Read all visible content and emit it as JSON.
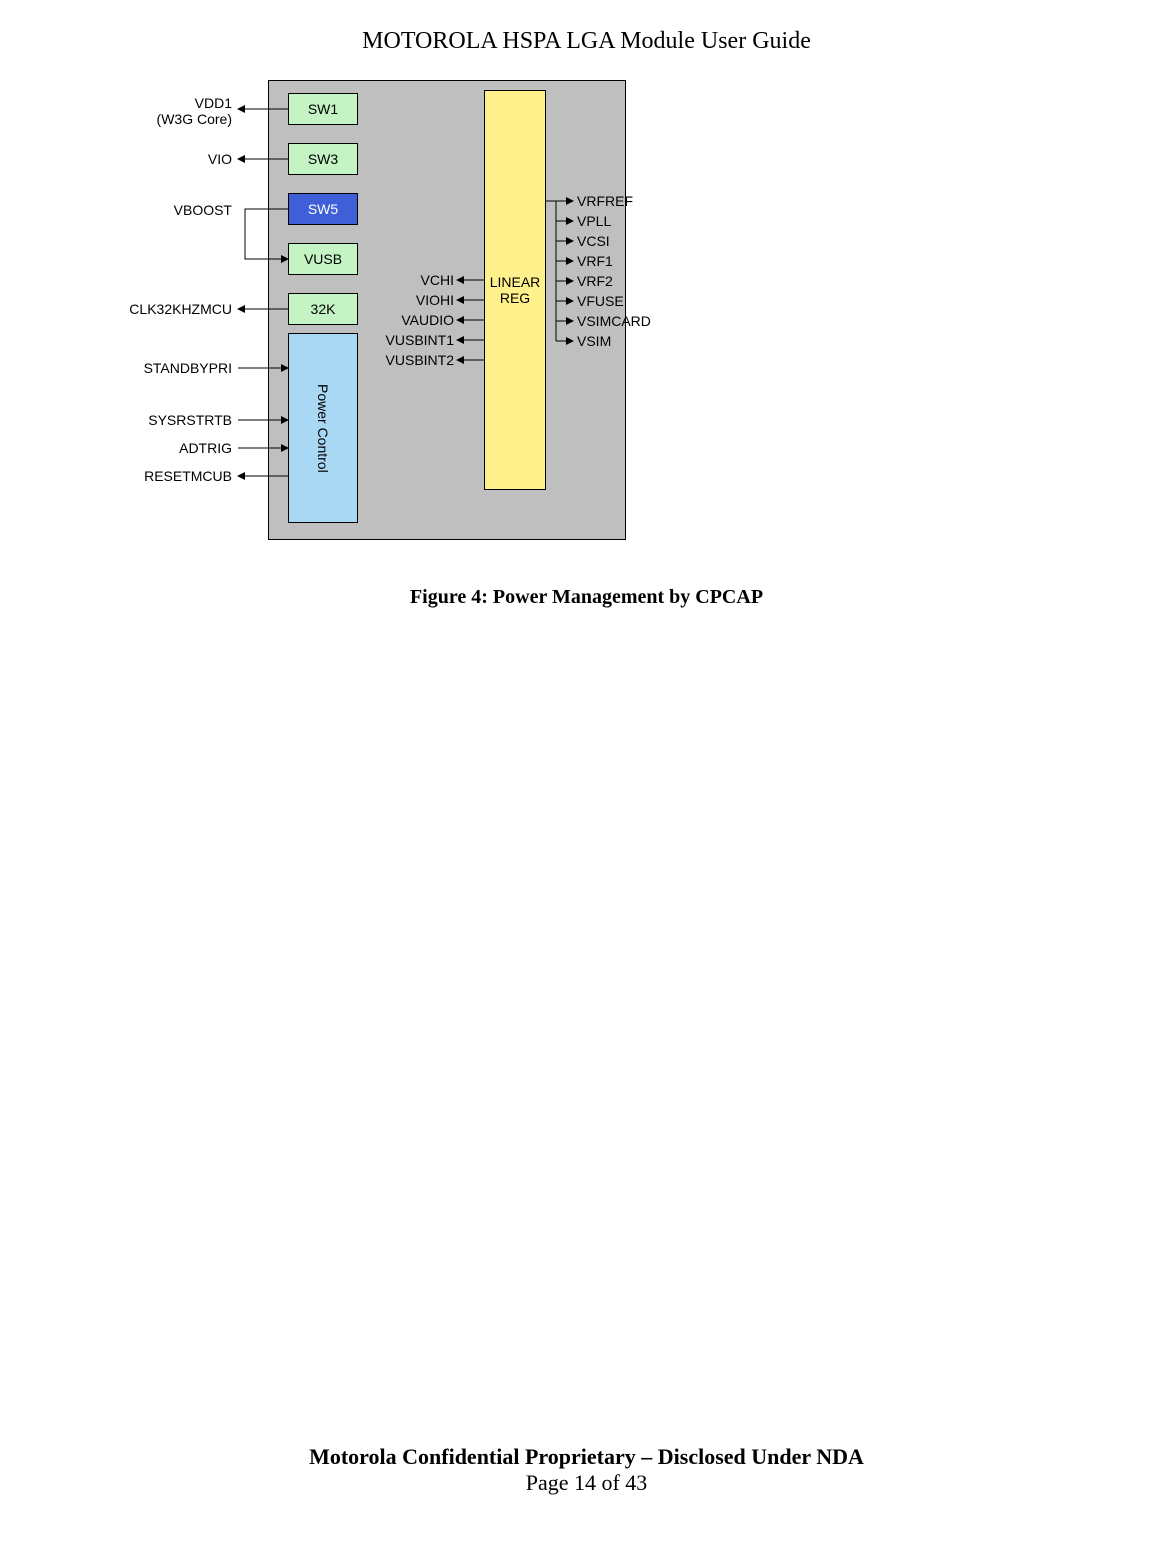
{
  "header": {
    "title": "MOTOROLA HSPA LGA Module User Guide"
  },
  "figure": {
    "caption": "Figure 4: Power Management by CPCAP",
    "blocks": {
      "sw1": "SW1",
      "sw3": "SW3",
      "sw5": "SW5",
      "vusb": "VUSB",
      "k32": "32K",
      "power_control": "Power Control",
      "linear_reg": "LINEAR REG"
    },
    "left_signals": [
      {
        "label": "VDD1\n(W3G Core)"
      },
      {
        "label": "VIO"
      },
      {
        "label": "VBOOST"
      },
      {
        "label": "CLK32KHZMCU"
      },
      {
        "label": "STANDBYPRI"
      },
      {
        "label": "SYSRSTRTB"
      },
      {
        "label": "ADTRIG"
      },
      {
        "label": "RESETMCUB"
      }
    ],
    "mid_signals": [
      {
        "label": "VCHI"
      },
      {
        "label": "VIOHI"
      },
      {
        "label": "VAUDIO"
      },
      {
        "label": "VUSBINT1"
      },
      {
        "label": "VUSBINT2"
      }
    ],
    "right_signals": [
      {
        "label": "VRFREF"
      },
      {
        "label": "VPLL"
      },
      {
        "label": "VCSI"
      },
      {
        "label": "VRF1"
      },
      {
        "label": "VRF2"
      },
      {
        "label": "VFUSE"
      },
      {
        "label": "VSIMCARD"
      },
      {
        "label": "VSIM"
      }
    ]
  },
  "footer": {
    "line1": "Motorola Confidential Proprietary – Disclosed Under NDA",
    "line2": "Page 14 of 43"
  }
}
